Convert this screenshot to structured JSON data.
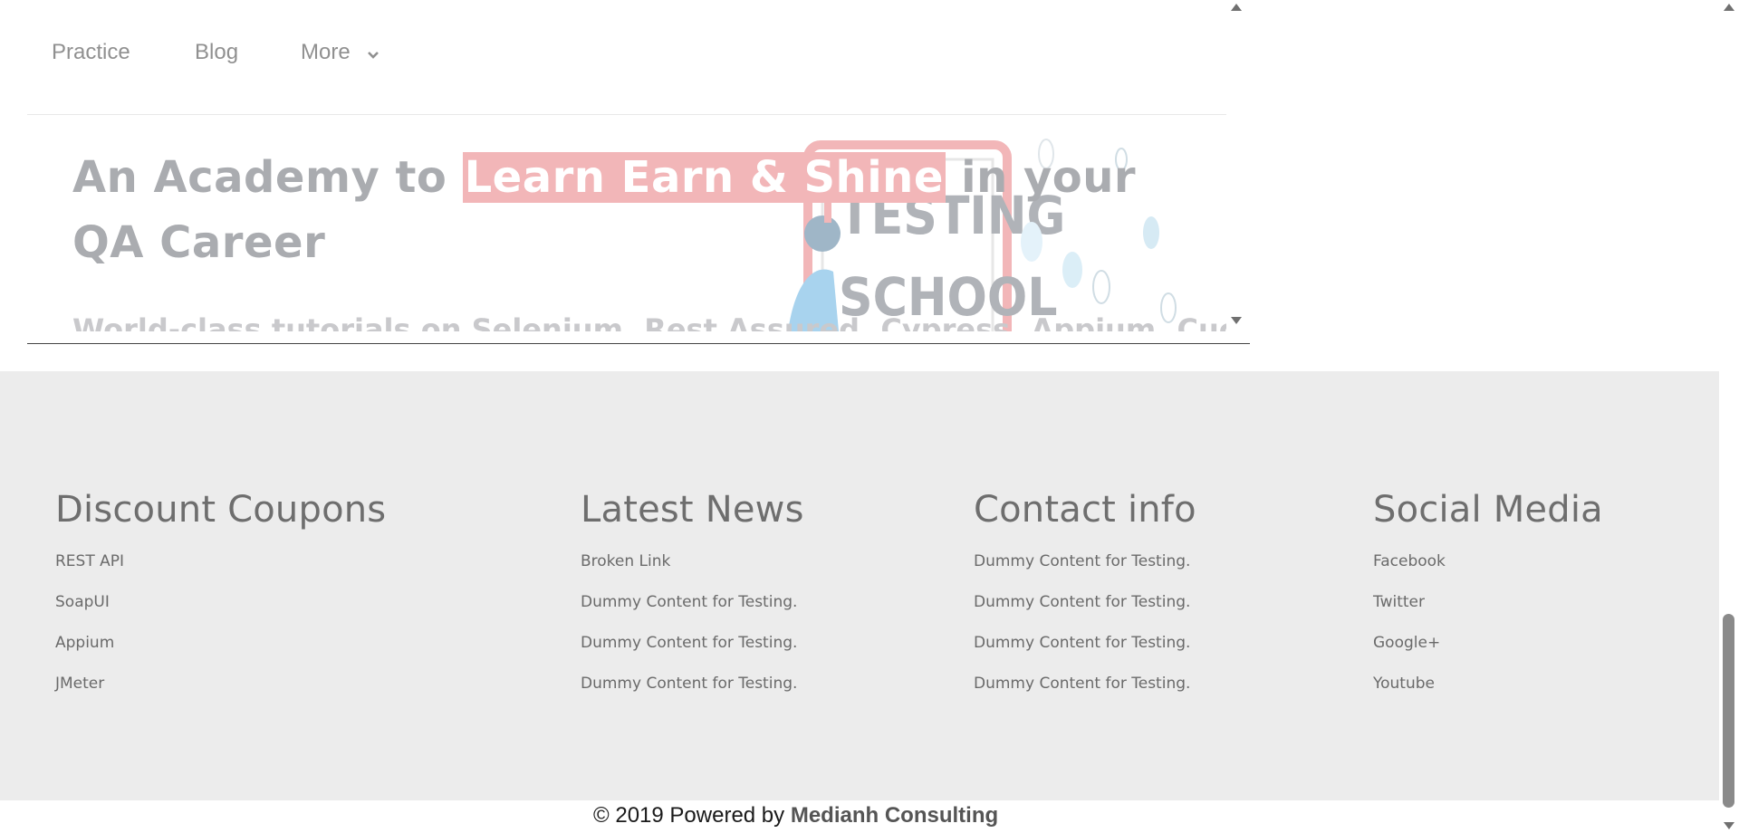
{
  "nav": {
    "items": [
      "Practice",
      "Blog",
      "More"
    ]
  },
  "hero": {
    "title_pre": "An Academy to ",
    "title_highlight": "Learn Earn & Shine",
    "title_post": "  in your QA Career",
    "subtitle_partial": "World-class tutorials on Selenium, Rest Assured, Cypress, Appium, Cucumber",
    "illustration_text": [
      "TESTING",
      "SCHOOL"
    ]
  },
  "footer": {
    "columns": [
      {
        "title": "Discount Coupons",
        "items": [
          "REST API",
          "SoapUI",
          "Appium",
          "JMeter"
        ]
      },
      {
        "title": "Latest News",
        "items": [
          "Broken Link",
          "Dummy Content for Testing.",
          "Dummy Content for Testing.",
          "Dummy Content for Testing."
        ]
      },
      {
        "title": "Contact info",
        "items": [
          "Dummy Content for Testing.",
          "Dummy Content for Testing.",
          "Dummy Content for Testing.",
          "Dummy Content for Testing."
        ]
      },
      {
        "title": "Social Media",
        "items": [
          "Facebook",
          "Twitter",
          "Google+",
          "Youtube"
        ]
      }
    ]
  },
  "copyright": {
    "prefix": "© 2019 Powered by ",
    "brand": "Medianh Consulting"
  },
  "colors": {
    "highlight_bg": "#f2b6b8",
    "footer_bg": "#ececec",
    "hero_text": "#aaacb0"
  }
}
